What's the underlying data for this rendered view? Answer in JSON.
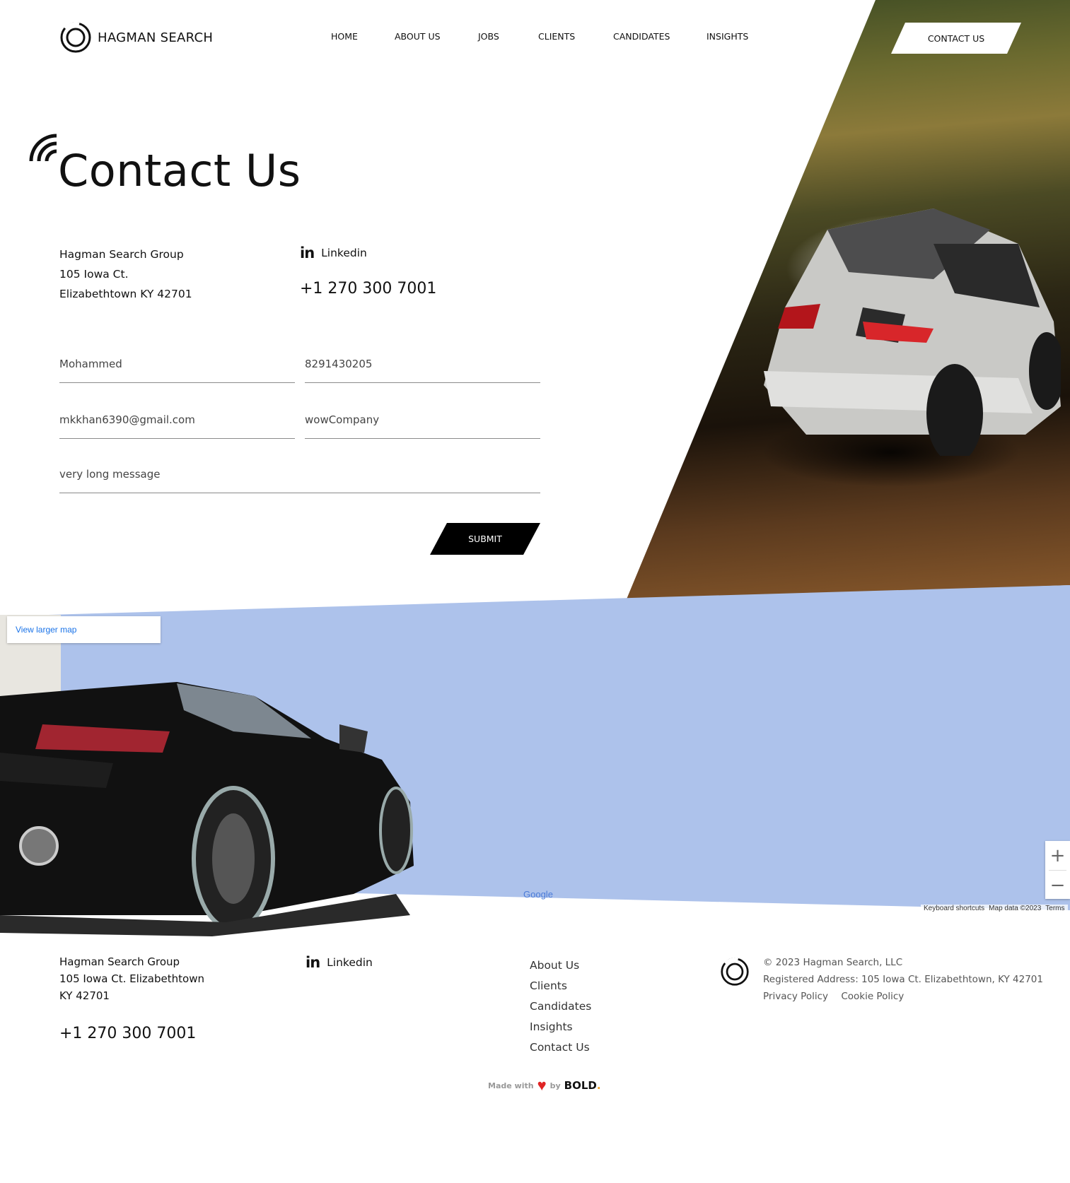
{
  "brand": {
    "name": "HAGMAN SEARCH"
  },
  "nav": {
    "items": [
      "HOME",
      "ABOUT US",
      "JOBS",
      "CLIENTS",
      "CANDIDATES",
      "INSIGHTS"
    ],
    "cta": "CONTACT US"
  },
  "page": {
    "title": "Contact Us"
  },
  "contact": {
    "address_lines": [
      "Hagman Search Group",
      "105 Iowa Ct.",
      "Elizabethtown KY 42701"
    ],
    "social_label": "Linkedin",
    "phone": "+1 270 300 7001"
  },
  "form": {
    "name_value": "Mohammed",
    "phone_value": "8291430205",
    "email_value": "mkkhan6390@gmail.com",
    "company_value": "wowCompany",
    "message_value": "very long message",
    "submit_label": "SUBMIT"
  },
  "map": {
    "larger_map_link": "View larger map",
    "zoom_in": "+",
    "zoom_out": "−",
    "provider": "Google",
    "attribution": [
      "Keyboard shortcuts",
      "Map data ©2023",
      "Terms"
    ]
  },
  "footer": {
    "address_lines": [
      "Hagman Search Group",
      "105 Iowa Ct. Elizabethtown",
      "KY 42701"
    ],
    "phone": "+1 270 300 7001",
    "social_label": "Linkedin",
    "links": [
      "About Us",
      "Clients",
      "Candidates",
      "Insights",
      "Contact Us"
    ],
    "copyright": "© 2023 Hagman Search, LLC",
    "registered_address": "Registered Address: 105 Iowa Ct. Elizabethtown, KY 42701",
    "privacy": "Privacy Policy",
    "cookie": "Cookie Policy",
    "made_with": "Made with",
    "by": "by",
    "agency": "BOLD",
    "agency_dot": "."
  },
  "colors": {
    "map_water": "#adc2eb",
    "accent_heart": "#e02424",
    "link_blue": "#1a73e8"
  }
}
